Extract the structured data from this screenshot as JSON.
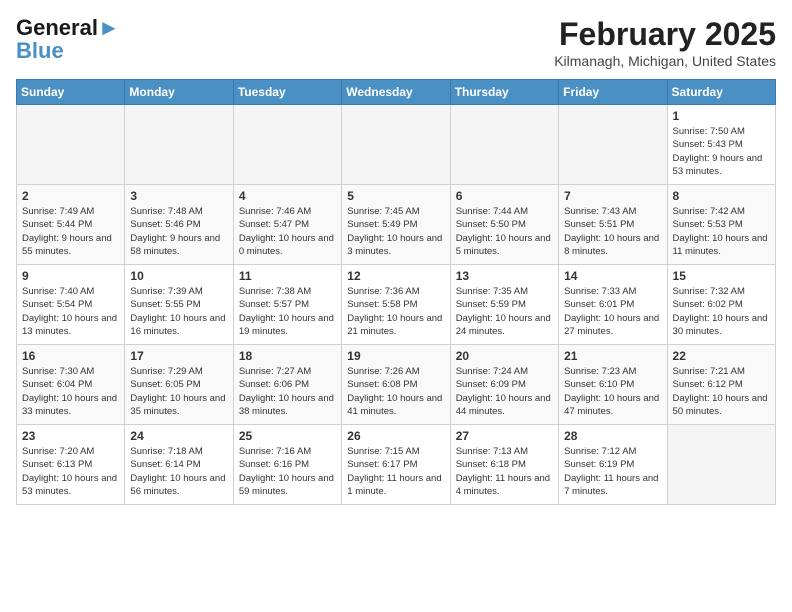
{
  "header": {
    "logo_line1": "General",
    "logo_line2": "Blue",
    "month_title": "February 2025",
    "location": "Kilmanagh, Michigan, United States"
  },
  "days_of_week": [
    "Sunday",
    "Monday",
    "Tuesday",
    "Wednesday",
    "Thursday",
    "Friday",
    "Saturday"
  ],
  "weeks": [
    [
      {
        "day": "",
        "empty": true
      },
      {
        "day": "",
        "empty": true
      },
      {
        "day": "",
        "empty": true
      },
      {
        "day": "",
        "empty": true
      },
      {
        "day": "",
        "empty": true
      },
      {
        "day": "",
        "empty": true
      },
      {
        "day": "1",
        "sunrise": "7:50 AM",
        "sunset": "5:43 PM",
        "daylight": "9 hours and 53 minutes."
      }
    ],
    [
      {
        "day": "2",
        "sunrise": "7:49 AM",
        "sunset": "5:44 PM",
        "daylight": "9 hours and 55 minutes."
      },
      {
        "day": "3",
        "sunrise": "7:48 AM",
        "sunset": "5:46 PM",
        "daylight": "9 hours and 58 minutes."
      },
      {
        "day": "4",
        "sunrise": "7:46 AM",
        "sunset": "5:47 PM",
        "daylight": "10 hours and 0 minutes."
      },
      {
        "day": "5",
        "sunrise": "7:45 AM",
        "sunset": "5:49 PM",
        "daylight": "10 hours and 3 minutes."
      },
      {
        "day": "6",
        "sunrise": "7:44 AM",
        "sunset": "5:50 PM",
        "daylight": "10 hours and 5 minutes."
      },
      {
        "day": "7",
        "sunrise": "7:43 AM",
        "sunset": "5:51 PM",
        "daylight": "10 hours and 8 minutes."
      },
      {
        "day": "8",
        "sunrise": "7:42 AM",
        "sunset": "5:53 PM",
        "daylight": "10 hours and 11 minutes."
      }
    ],
    [
      {
        "day": "9",
        "sunrise": "7:40 AM",
        "sunset": "5:54 PM",
        "daylight": "10 hours and 13 minutes."
      },
      {
        "day": "10",
        "sunrise": "7:39 AM",
        "sunset": "5:55 PM",
        "daylight": "10 hours and 16 minutes."
      },
      {
        "day": "11",
        "sunrise": "7:38 AM",
        "sunset": "5:57 PM",
        "daylight": "10 hours and 19 minutes."
      },
      {
        "day": "12",
        "sunrise": "7:36 AM",
        "sunset": "5:58 PM",
        "daylight": "10 hours and 21 minutes."
      },
      {
        "day": "13",
        "sunrise": "7:35 AM",
        "sunset": "5:59 PM",
        "daylight": "10 hours and 24 minutes."
      },
      {
        "day": "14",
        "sunrise": "7:33 AM",
        "sunset": "6:01 PM",
        "daylight": "10 hours and 27 minutes."
      },
      {
        "day": "15",
        "sunrise": "7:32 AM",
        "sunset": "6:02 PM",
        "daylight": "10 hours and 30 minutes."
      }
    ],
    [
      {
        "day": "16",
        "sunrise": "7:30 AM",
        "sunset": "6:04 PM",
        "daylight": "10 hours and 33 minutes."
      },
      {
        "day": "17",
        "sunrise": "7:29 AM",
        "sunset": "6:05 PM",
        "daylight": "10 hours and 35 minutes."
      },
      {
        "day": "18",
        "sunrise": "7:27 AM",
        "sunset": "6:06 PM",
        "daylight": "10 hours and 38 minutes."
      },
      {
        "day": "19",
        "sunrise": "7:26 AM",
        "sunset": "6:08 PM",
        "daylight": "10 hours and 41 minutes."
      },
      {
        "day": "20",
        "sunrise": "7:24 AM",
        "sunset": "6:09 PM",
        "daylight": "10 hours and 44 minutes."
      },
      {
        "day": "21",
        "sunrise": "7:23 AM",
        "sunset": "6:10 PM",
        "daylight": "10 hours and 47 minutes."
      },
      {
        "day": "22",
        "sunrise": "7:21 AM",
        "sunset": "6:12 PM",
        "daylight": "10 hours and 50 minutes."
      }
    ],
    [
      {
        "day": "23",
        "sunrise": "7:20 AM",
        "sunset": "6:13 PM",
        "daylight": "10 hours and 53 minutes."
      },
      {
        "day": "24",
        "sunrise": "7:18 AM",
        "sunset": "6:14 PM",
        "daylight": "10 hours and 56 minutes."
      },
      {
        "day": "25",
        "sunrise": "7:16 AM",
        "sunset": "6:16 PM",
        "daylight": "10 hours and 59 minutes."
      },
      {
        "day": "26",
        "sunrise": "7:15 AM",
        "sunset": "6:17 PM",
        "daylight": "11 hours and 1 minute."
      },
      {
        "day": "27",
        "sunrise": "7:13 AM",
        "sunset": "6:18 PM",
        "daylight": "11 hours and 4 minutes."
      },
      {
        "day": "28",
        "sunrise": "7:12 AM",
        "sunset": "6:19 PM",
        "daylight": "11 hours and 7 minutes."
      },
      {
        "day": "",
        "empty": true
      }
    ]
  ]
}
